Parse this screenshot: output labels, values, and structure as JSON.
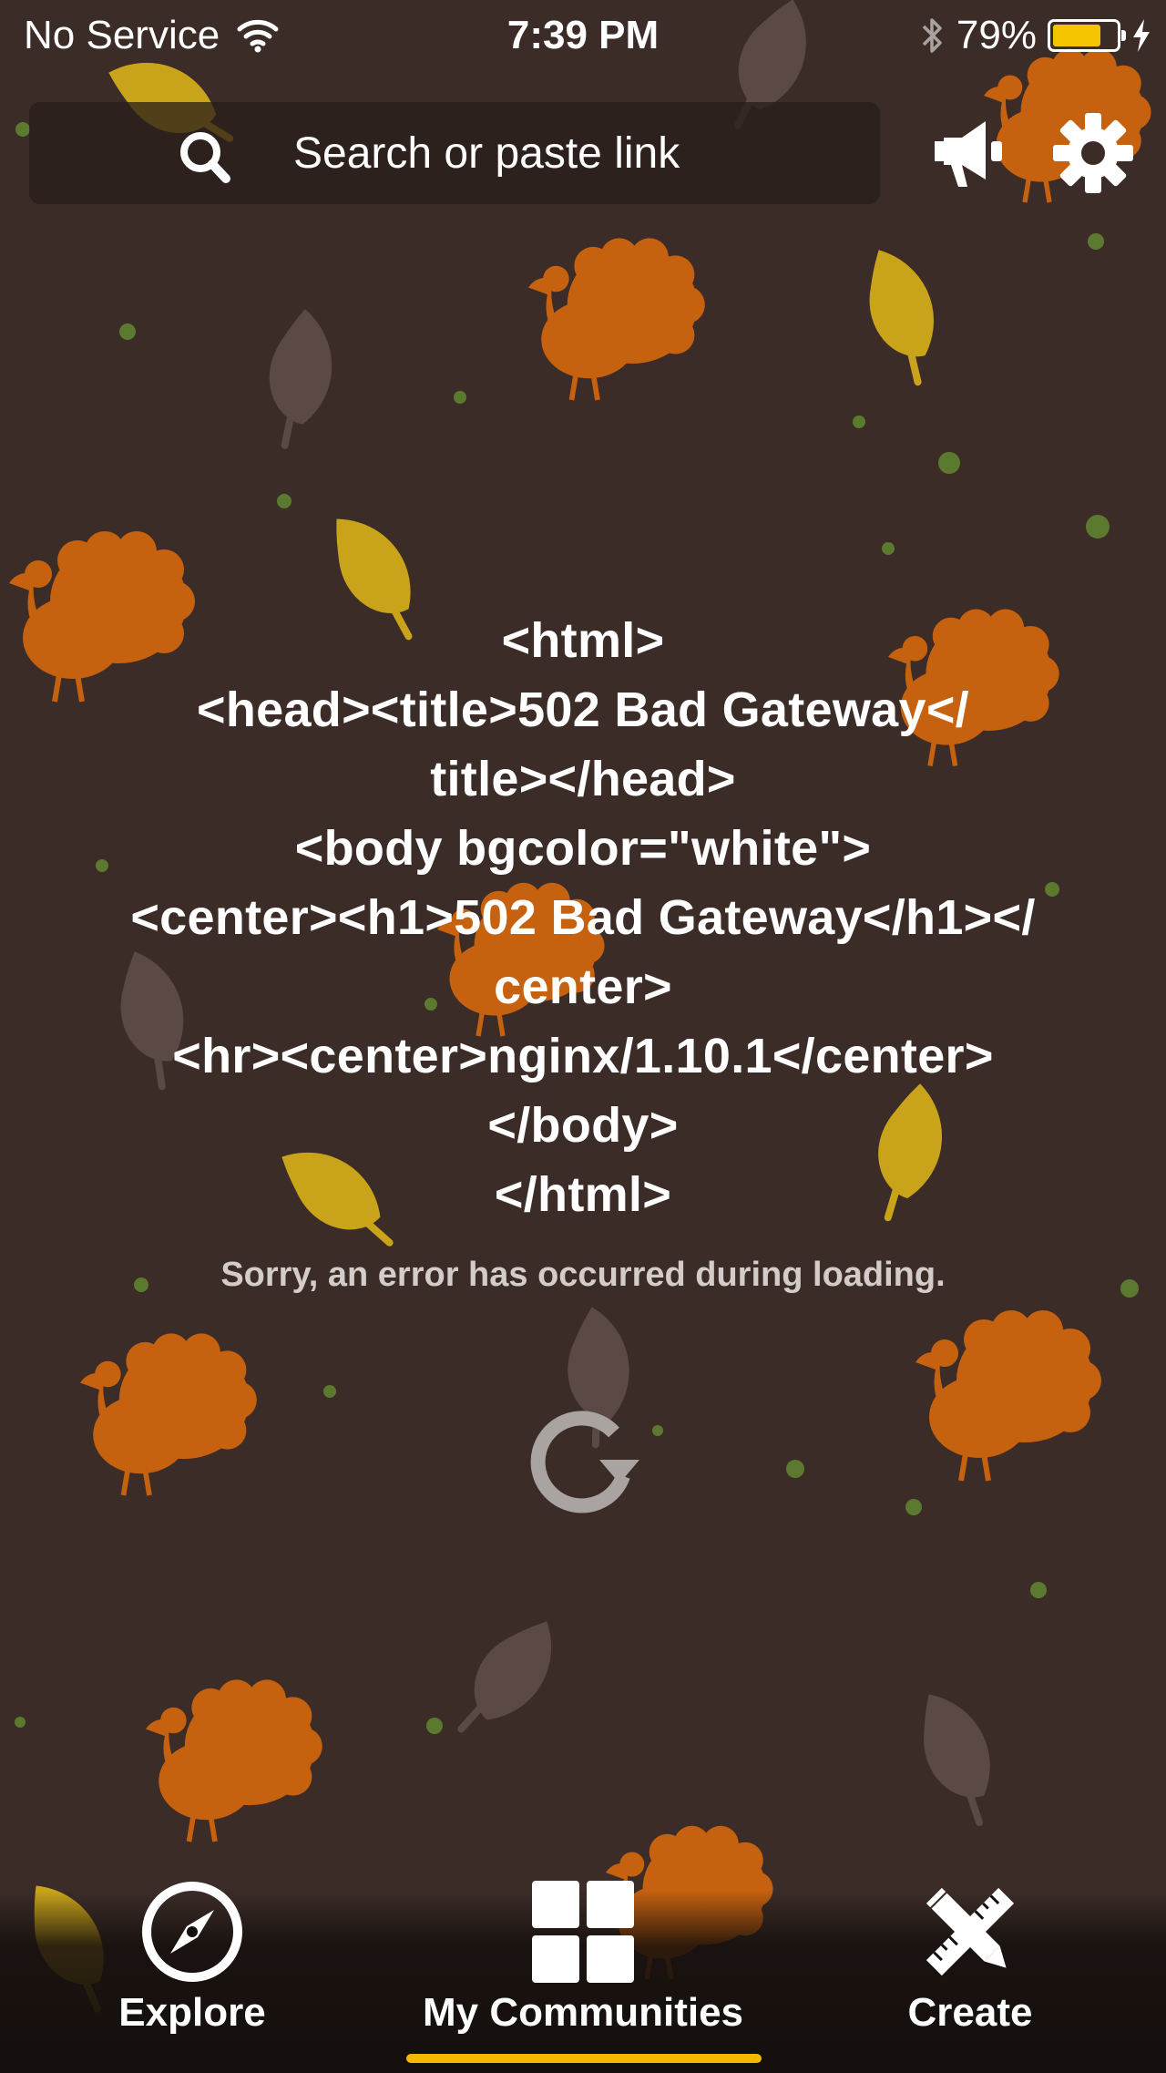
{
  "status_bar": {
    "carrier": "No Service",
    "time": "7:39 PM",
    "battery_percent": "79%",
    "battery_level": 0.79,
    "battery_color": "#f5c400"
  },
  "search": {
    "placeholder": "Search or paste link",
    "icon": "search-icon"
  },
  "header_actions": {
    "announcements_icon": "megaphone-icon",
    "settings_icon": "gear-icon"
  },
  "error": {
    "raw_response": "<html>\n<head><title>502 Bad Gateway</\ntitle></head>\n<body bgcolor=\"white\">\n<center><h1>502 Bad Gateway</h1></\ncenter>\n<hr><center>nginx/1.10.1</center>\n</body>\n</html>",
    "message": "Sorry, an error has occurred during loading.",
    "reload_icon": "reload-icon"
  },
  "tab_bar": {
    "tabs": [
      {
        "label": "Explore",
        "icon": "compass-icon",
        "active": false
      },
      {
        "label": "My Communities",
        "icon": "grid-icon",
        "active": true
      },
      {
        "label": "Create",
        "icon": "pencil-ruler-icon",
        "active": false
      }
    ],
    "accent": "#f5b800"
  },
  "theme": {
    "background": "#3b2c27",
    "turkey": "#c5610f",
    "leaf_gold": "#c9a41b",
    "leaf_muted": "#5a4944",
    "dot": "#5c7a2f"
  }
}
